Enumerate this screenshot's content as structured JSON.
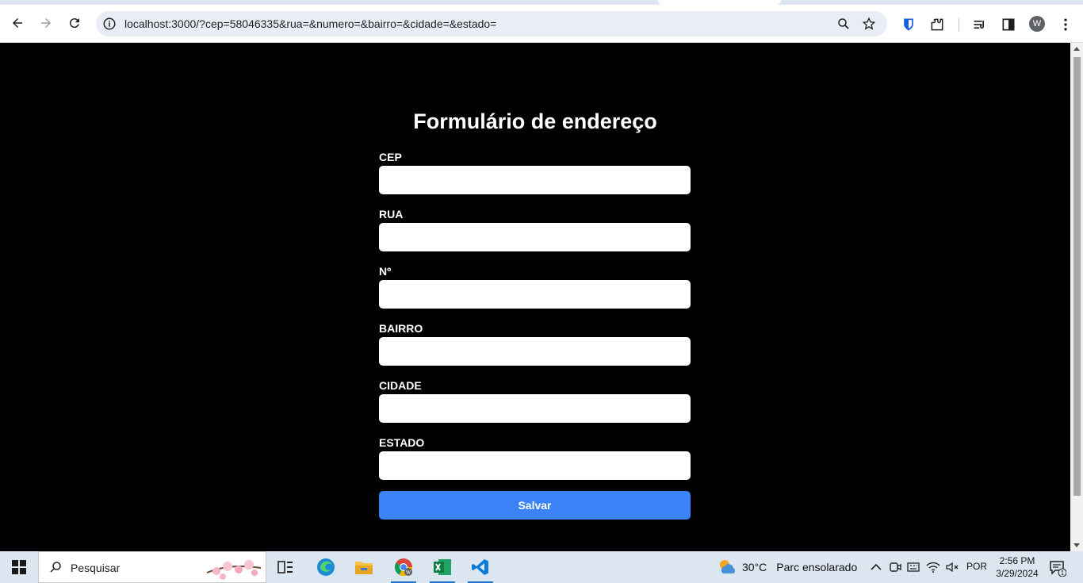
{
  "browser": {
    "url": "localhost:3000/?cep=58046335&rua=&numero=&bairro=&cidade=&estado=",
    "profile_initial": "W"
  },
  "form": {
    "title": "Formulário de endereço",
    "fields": [
      {
        "label": "CEP",
        "value": ""
      },
      {
        "label": "RUA",
        "value": ""
      },
      {
        "label": "Nº",
        "value": ""
      },
      {
        "label": "BAIRRO",
        "value": ""
      },
      {
        "label": "CIDADE",
        "value": ""
      },
      {
        "label": "ESTADO",
        "value": ""
      }
    ],
    "submit_label": "Salvar",
    "submit_color": "#3b82f6"
  },
  "taskbar": {
    "search_placeholder": "Pesquisar",
    "weather_temp": "30°C",
    "weather_desc": "Parc ensolarado",
    "language": "POR",
    "time": "2:56 PM",
    "date": "3/29/2024",
    "notification_count": "1"
  }
}
